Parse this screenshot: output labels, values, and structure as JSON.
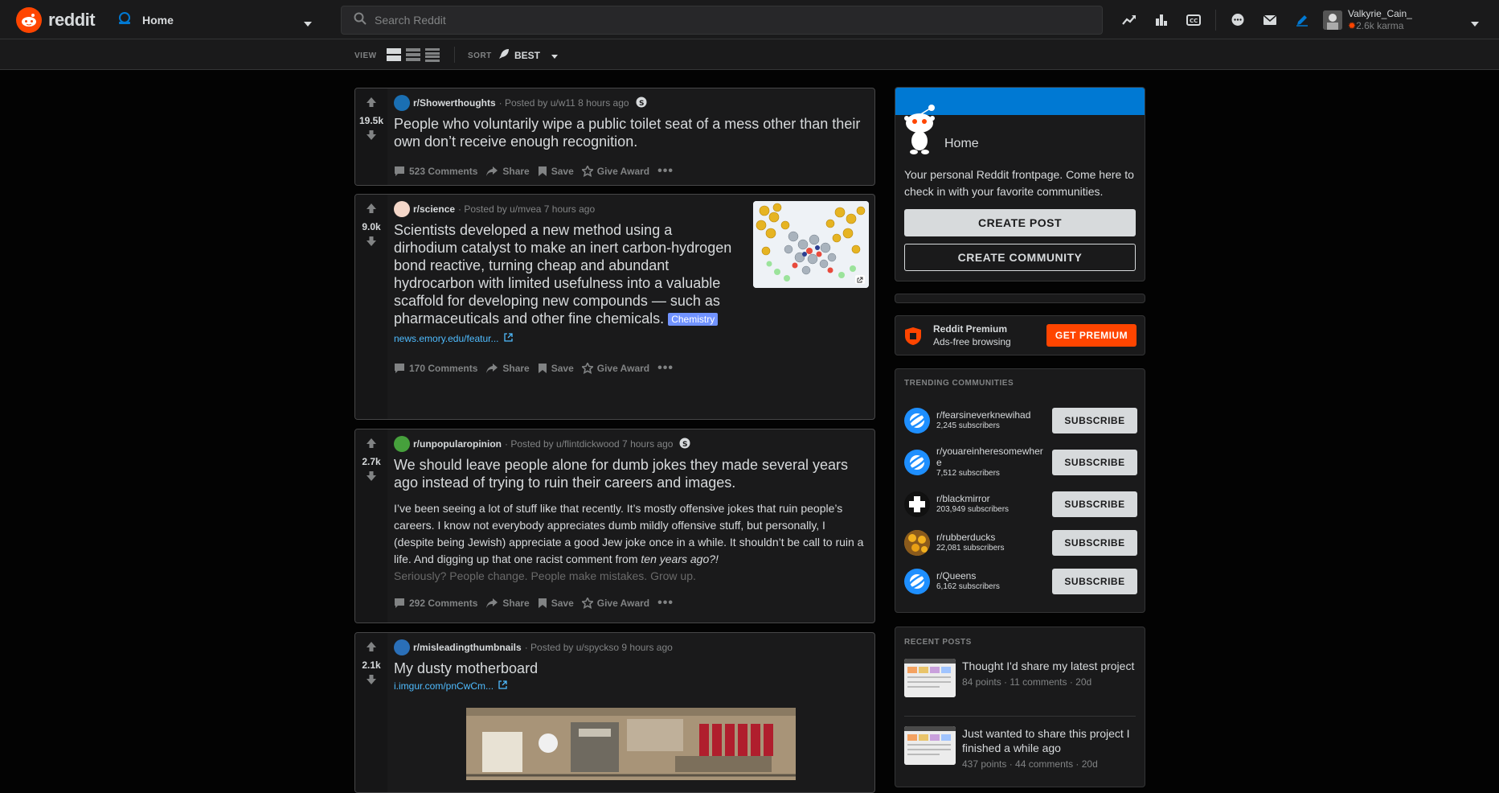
{
  "header": {
    "logo_text": "reddit",
    "feed_label": "Home",
    "search_placeholder": "Search Reddit",
    "user": {
      "name": "Valkyrie_Cain_",
      "karma": "2.6k karma"
    }
  },
  "subheader": {
    "view_label": "VIEW",
    "sort_label": "SORT",
    "sort_value": "BEST"
  },
  "posts": [
    {
      "subreddit": "r/Showerthoughts",
      "posted_by": "· Posted by u/w11 8 hours ago",
      "votes": "19.5k",
      "title": "People who voluntarily wipe a public toilet seat of a mess other than their own don’t receive enough recognition.",
      "comments": "523 Comments"
    },
    {
      "subreddit": "r/science",
      "posted_by": "· Posted by u/mvea 7 hours ago",
      "votes": "9.0k",
      "title": "Scientists developed a new method using a dirhodium catalyst to make an inert carbon-hydrogen bond reactive, turning cheap and abundant hydrocarbon with limited usefulness into a valuable scaffold for developing new compounds — such as pharmaceuticals and other fine chemicals.",
      "flair": "Chemistry",
      "link": "news.emory.edu/featur...",
      "comments": "170 Comments"
    },
    {
      "subreddit": "r/unpopularopinion",
      "posted_by": "· Posted by u/flintdickwood 7 hours ago",
      "votes": "2.7k",
      "title": "We should leave people alone for dumb jokes they made several years ago instead of trying to ruin their careers and images.",
      "body_main": "I’ve been seeing a lot of stuff like that recently. It’s mostly offensive jokes that ruin people’s careers. I know not everybody appreciates dumb mildly offensive stuff, but personally, I (despite being Jewish) appreciate a good Jew joke once in a while. It shouldn’t be call to ruin a life. And digging up that one racist comment from",
      "body_italic": "ten years ago?!",
      "body_fade": "Seriously? People change. People make mistakes. Grow up.",
      "comments": "292 Comments"
    },
    {
      "subreddit": "r/misleadingthumbnails",
      "posted_by": "· Posted by u/spyckso 9 hours ago",
      "votes": "2.1k",
      "title": "My dusty motherboard",
      "link": "i.imgur.com/pnCwCm..."
    }
  ],
  "actions": {
    "share": "Share",
    "save": "Save",
    "award": "Give Award"
  },
  "sidebar": {
    "home_card": {
      "title": "Home",
      "description": "Your personal Reddit frontpage. Come here to check in with your favorite communities.",
      "create_post": "CREATE POST",
      "create_community": "CREATE COMMUNITY"
    },
    "premium": {
      "title": "Reddit Premium",
      "subtitle": "Ads-free browsing",
      "button": "GET PREMIUM"
    },
    "trending": {
      "title": "TRENDING COMMUNITIES",
      "button": "SUBSCRIBE",
      "items": [
        {
          "name": "r/fearsineverknewihad",
          "subs": "2,245 subscribers"
        },
        {
          "name": "r/youareinheresomewhere",
          "subs": "7,512 subscribers"
        },
        {
          "name": "r/blackmirror",
          "subs": "203,949 subscribers"
        },
        {
          "name": "r/rubberducks",
          "subs": "22,081 subscribers"
        },
        {
          "name": "r/Queens",
          "subs": "6,162 subscribers"
        }
      ]
    },
    "recent": {
      "title": "RECENT POSTS",
      "items": [
        {
          "title": "Thought I'd share my latest project",
          "meta": "84 points · 11 comments · 20d"
        },
        {
          "title": "Just wanted to share this project I finished a while ago",
          "meta": "437 points · 44 comments · 20d"
        }
      ]
    }
  },
  "colors": {
    "accent": "#ff4500",
    "link": "#4fbcff",
    "home_banner": "#0079d3",
    "flair": "#7193ff"
  }
}
